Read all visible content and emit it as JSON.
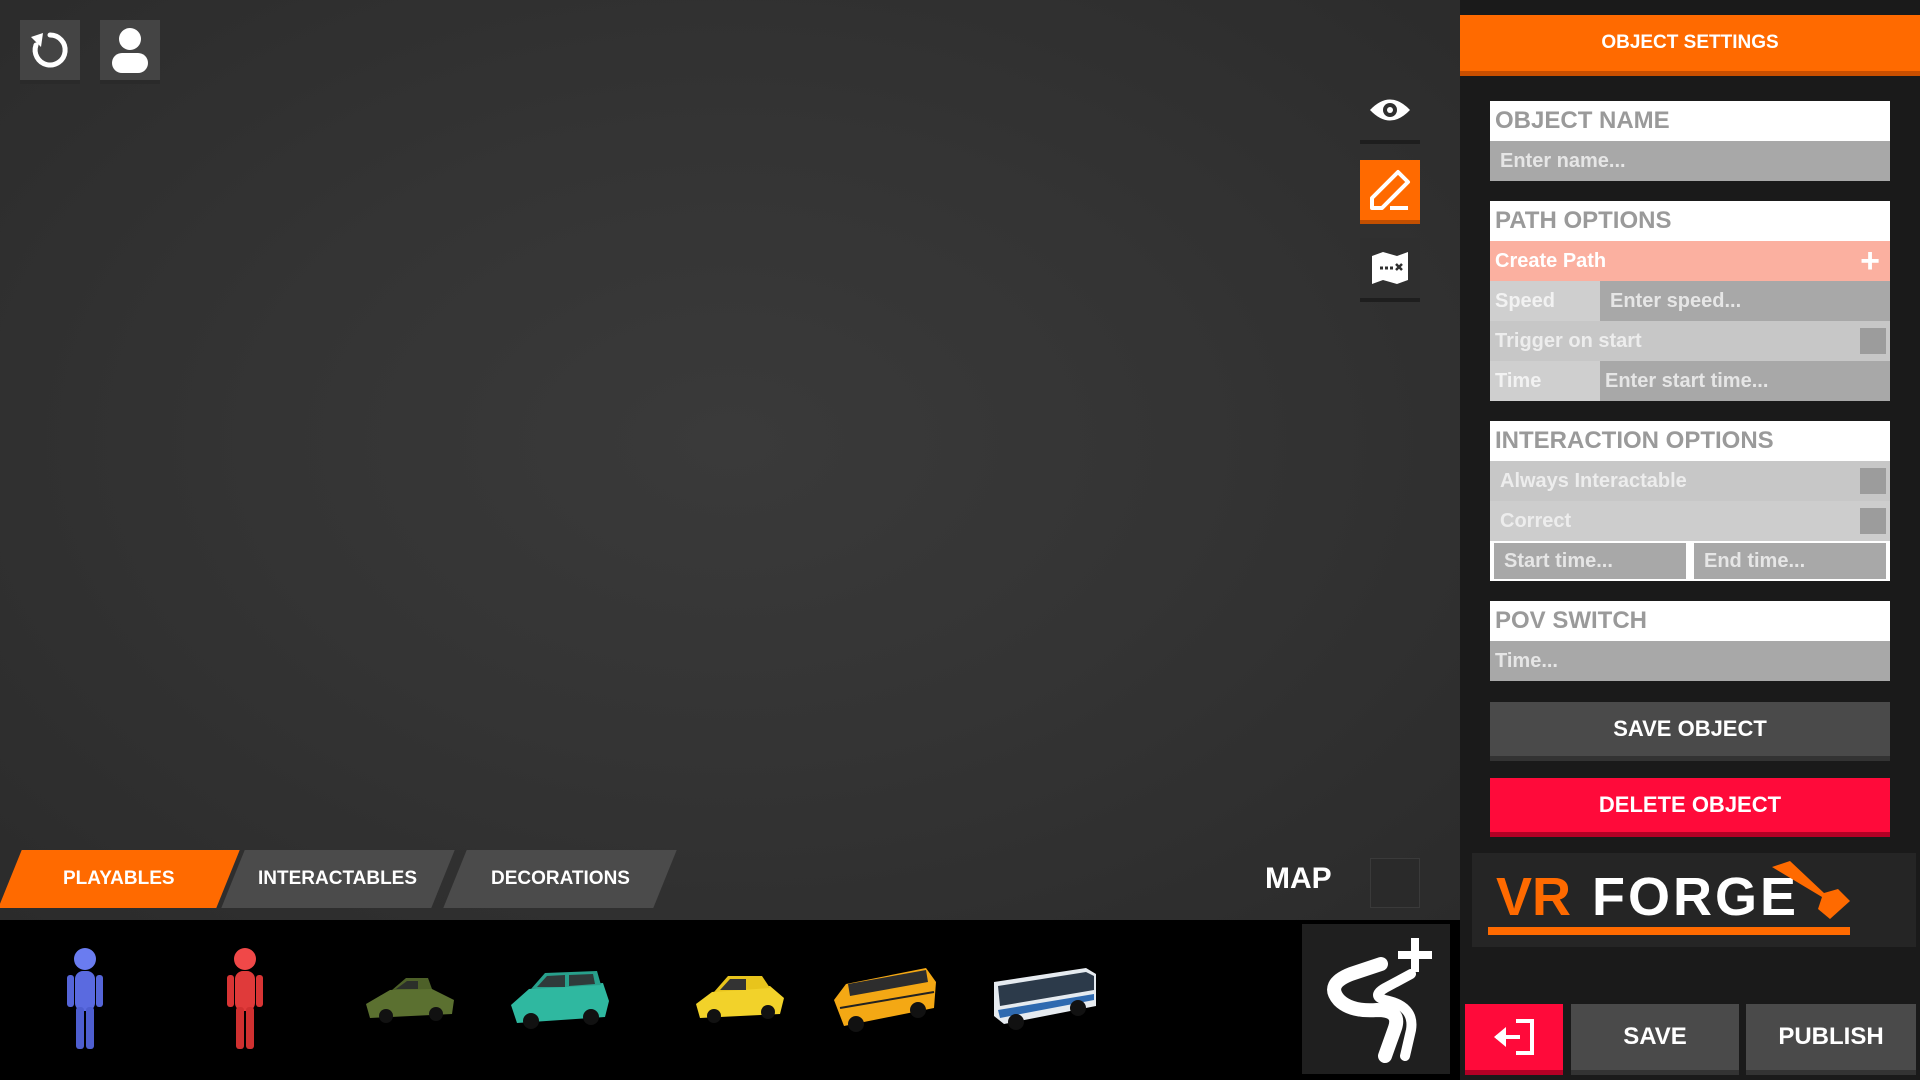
{
  "toolbar": {
    "top_left": [
      "undo-icon",
      "user-icon"
    ],
    "tools": [
      "eye-icon",
      "pencil-icon",
      "map-icon"
    ],
    "active_tool": "pencil-icon"
  },
  "tabs": [
    {
      "label": "PLAYABLES",
      "active": true
    },
    {
      "label": "INTERACTABLES",
      "active": false
    },
    {
      "label": "DECORATIONS",
      "active": false
    }
  ],
  "map": {
    "label": "MAP"
  },
  "tray": {
    "items": [
      "blue-person",
      "red-person",
      "green-sedan",
      "teal-station-wagon",
      "yellow-hatchback",
      "school-bus",
      "coach-bus"
    ],
    "path_button": "add-path-icon"
  },
  "panel": {
    "header": "OBJECT SETTINGS",
    "object_name": {
      "title": "OBJECT NAME",
      "placeholder": "Enter name..."
    },
    "path_options": {
      "title": "PATH OPTIONS",
      "create_path": "Create Path",
      "speed_label": "Speed",
      "speed_placeholder": "Enter speed...",
      "trigger_label": "Trigger on start",
      "time_label": "Time",
      "time_placeholder": "Enter start time..."
    },
    "interaction_options": {
      "title": "INTERACTION OPTIONS",
      "always_interactable": "Always Interactable",
      "correct": "Correct",
      "start_placeholder": "Start time...",
      "end_placeholder": "End time..."
    },
    "pov_switch": {
      "title": "POV SWITCH",
      "placeholder": "Time..."
    },
    "save_object": "SAVE OBJECT",
    "delete_object": "DELETE OBJECT",
    "logo": {
      "vr": "VR",
      "forge": "FORGE"
    },
    "bottom": {
      "exit_icon": "exit-icon",
      "save": "SAVE",
      "publish": "PUBLISH"
    }
  },
  "colors": {
    "accent": "#ff6a00",
    "danger": "#ff0a3a",
    "panel_bg": "#1a1a1a",
    "viewport_bg": "#333333"
  }
}
